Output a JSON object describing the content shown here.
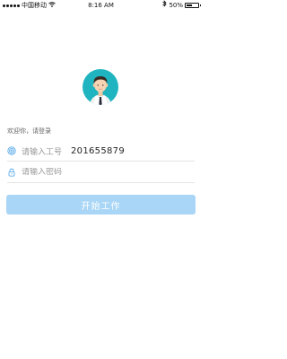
{
  "status_bar": {
    "carrier": "中国移动",
    "time": "8:16 AM",
    "battery_percent": "50%",
    "battery_level": 0.5
  },
  "login": {
    "greeting": "欢迎你，请登录",
    "account_hint": "请输入工号",
    "account_value": "201655879",
    "password_placeholder": "请输入密码",
    "start_button_label": "开始工作"
  },
  "colors": {
    "accent": "#1fb4bf",
    "button_disabled": "#a9d6f6",
    "icon_blue": "#4aa3e8"
  },
  "icons": {
    "account": "fingerprint-icon",
    "password": "lock-icon",
    "avatar": "user-avatar",
    "wifi": "wifi-icon",
    "bluetooth": "bluetooth-icon",
    "battery": "battery-icon"
  }
}
